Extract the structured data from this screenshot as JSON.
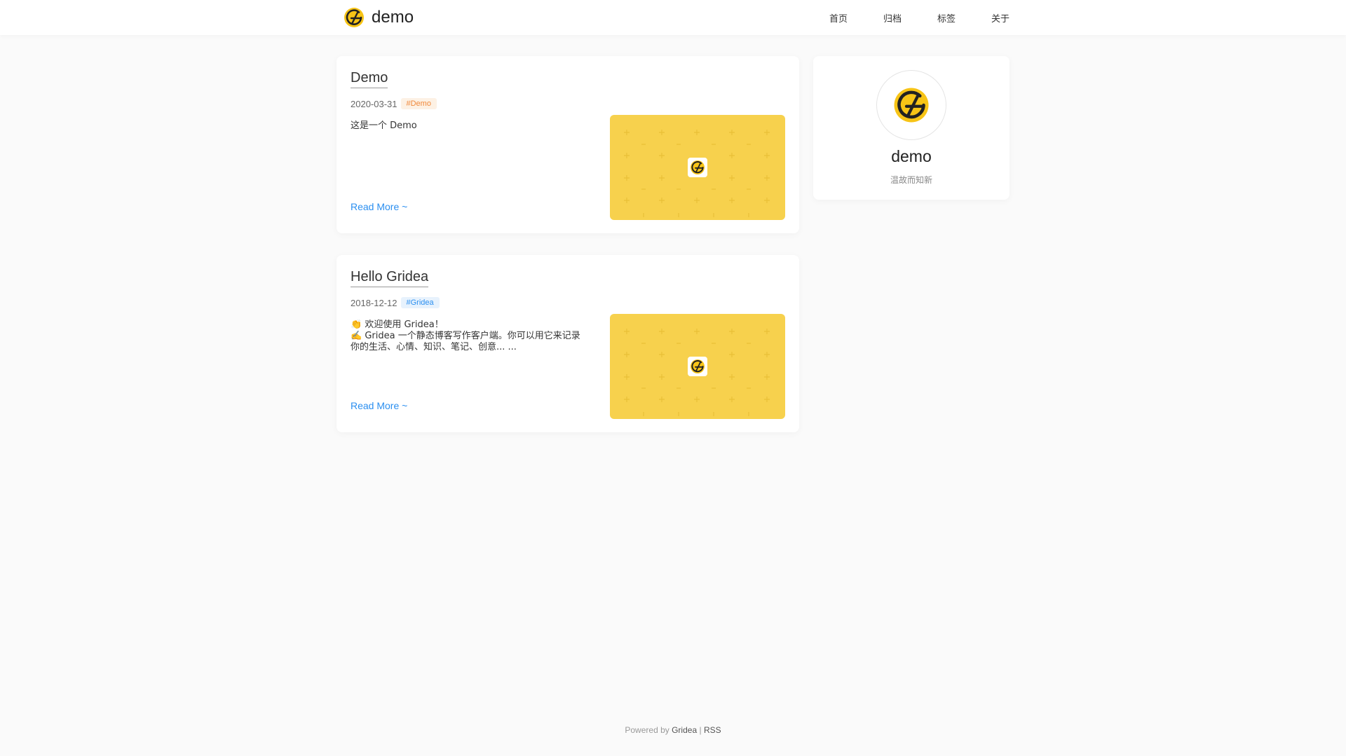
{
  "header": {
    "site_name": "demo",
    "logo_icon": "gridea-logo-icon",
    "nav": [
      {
        "label": "首页"
      },
      {
        "label": "归档"
      },
      {
        "label": "标签"
      },
      {
        "label": "关于"
      }
    ]
  },
  "posts": [
    {
      "title": "Demo",
      "date": "2020-03-31",
      "tag": "#Demo",
      "tag_color": "#f0883a",
      "tag_bg": "#fdf1e4",
      "abstract_lines": [
        "这是一个 Demo"
      ],
      "read_more": "Read More ~",
      "feature_icon": "gridea-logo-icon"
    },
    {
      "title": "Hello Gridea",
      "date": "2018-12-12",
      "tag": "#Gridea",
      "tag_color": "#2b8ff0",
      "tag_bg": "#e7f2fd",
      "abstract_lines": [
        "👏 欢迎使用 Gridea！",
        "✍️ Gridea 一个静态博客写作客户端。你可以用它来记录",
        "你的生活、心情、知识、笔记、创意... ..."
      ],
      "read_more": "Read More ~",
      "feature_icon": "gridea-logo-icon"
    }
  ],
  "profile": {
    "name": "demo",
    "description": "温故而知新",
    "avatar_icon": "gridea-logo-icon"
  },
  "footer": {
    "powered_by": "Powered by",
    "gridea_link": "Gridea",
    "separator": "|",
    "rss_link": "RSS"
  },
  "colors": {
    "accent_yellow": "#f7d14d",
    "link_blue": "#2b8ff0",
    "page_bg": "#fafafa"
  }
}
